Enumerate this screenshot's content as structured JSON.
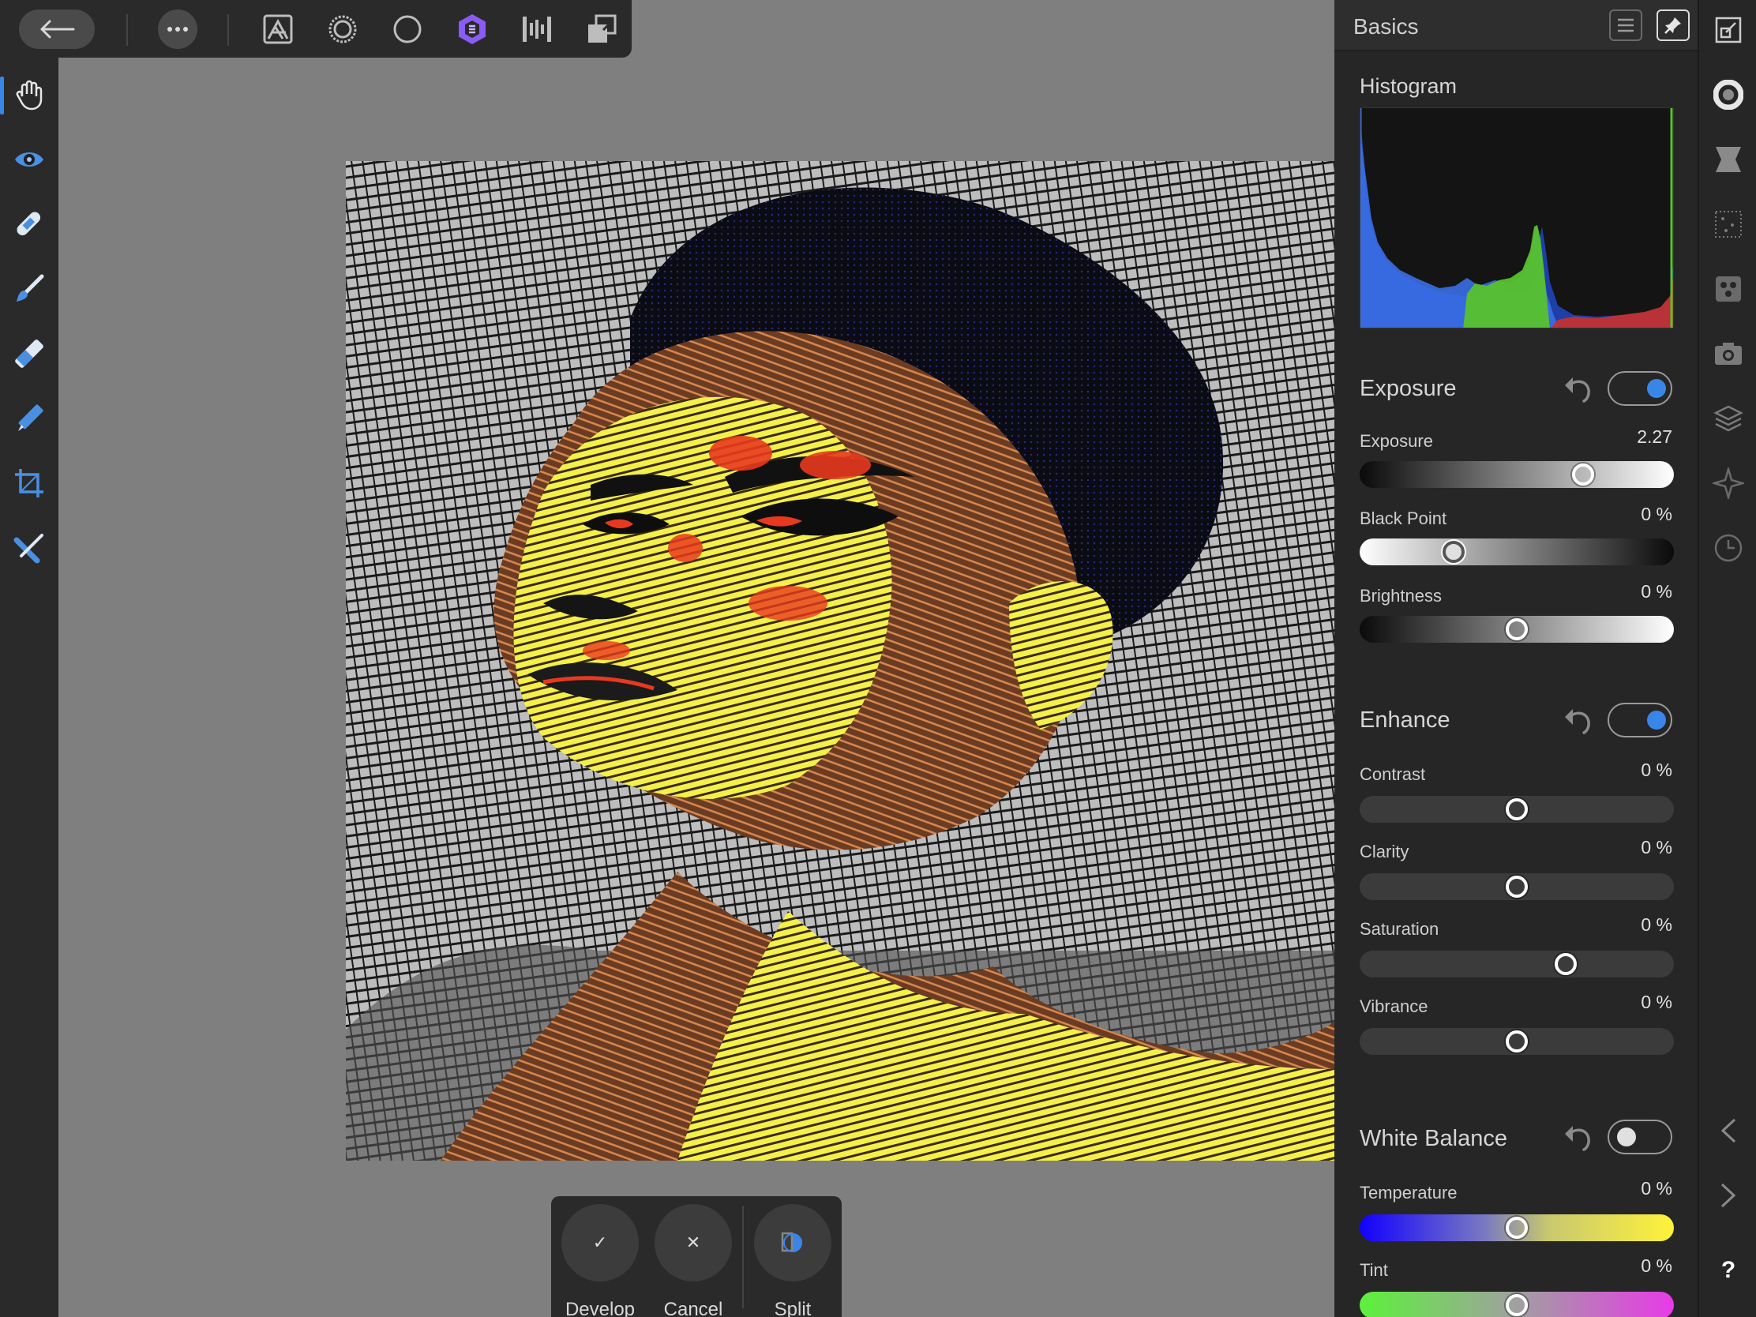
{
  "toolbar": {
    "back_icon": "arrow-left-icon",
    "more_icon": "ellipsis-icon",
    "personas": [
      {
        "name": "photo-persona-icon"
      },
      {
        "name": "liquify-persona-icon"
      },
      {
        "name": "develop-persona-icon"
      },
      {
        "name": "tone-mapping-persona-icon",
        "active": true
      },
      {
        "name": "export-persona-icon"
      },
      {
        "name": "arrange-icon"
      }
    ]
  },
  "left_tools": [
    "view-tool-icon",
    "red-eye-tool-icon",
    "blemish-tool-icon",
    "brush-tool-icon",
    "gradient-tool-icon",
    "selection-brush-icon",
    "crop-tool-icon",
    "straighten-tool-icon"
  ],
  "actions": {
    "develop": {
      "label": "Develop",
      "glyph": "✓"
    },
    "cancel": {
      "label": "Cancel",
      "glyph": "✕"
    },
    "split": {
      "label": "Split"
    }
  },
  "panel": {
    "title": "Basics",
    "histogram": {
      "title": "Histogram"
    },
    "exposure": {
      "title": "Exposure",
      "enabled": true,
      "rows": [
        {
          "label": "Exposure",
          "value": "2.27",
          "pos": 0.71
        },
        {
          "label": "Black Point",
          "value": "0 %",
          "pos": 0.3
        },
        {
          "label": "Brightness",
          "value": "0 %",
          "pos": 0.5
        }
      ]
    },
    "enhance": {
      "title": "Enhance",
      "enabled": true,
      "rows": [
        {
          "label": "Contrast",
          "value": "0 %",
          "pos": 0.5
        },
        {
          "label": "Clarity",
          "value": "0 %",
          "pos": 0.5
        },
        {
          "label": "Saturation",
          "value": "0 %",
          "pos": 0.655
        },
        {
          "label": "Vibrance",
          "value": "0 %",
          "pos": 0.5
        }
      ]
    },
    "white_balance": {
      "title": "White Balance",
      "enabled": false,
      "rows": [
        {
          "label": "Temperature",
          "value": "0 %",
          "pos": 0.5
        },
        {
          "label": "Tint",
          "value": "0 %",
          "pos": 0.5
        }
      ]
    }
  },
  "studio": {
    "icons": [
      "navigator-icon",
      "color-wheel-icon",
      "swatches-icon",
      "brushes-icon",
      "adjustments-icon",
      "camera-icon",
      "layers-icon",
      "transform-icon",
      "history-icon"
    ],
    "prev_icon": "chevron-left-icon",
    "next_icon": "chevron-right-icon",
    "help": "?"
  },
  "colors": {
    "accent": "#3a86e8",
    "persona_active": "#8a5cf6"
  }
}
